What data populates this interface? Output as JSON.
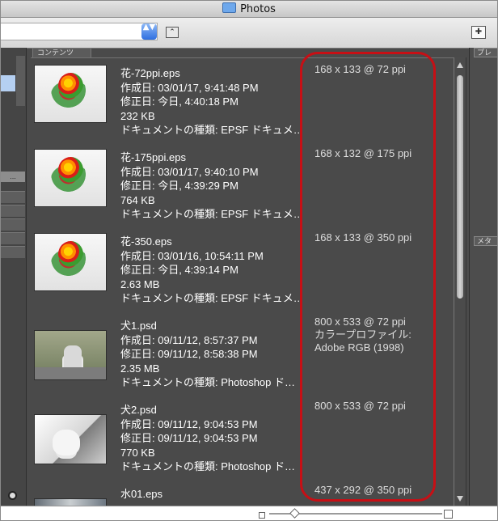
{
  "window": {
    "title": "Photos"
  },
  "toolbar": {
    "stepper": "▲▼",
    "up": "⌃",
    "new_folder": "✚"
  },
  "panels": {
    "left_header": "...",
    "content_tab": "コンテンツ",
    "right_tab_top": "プレ",
    "right_tab_mid": "メタ"
  },
  "items": [
    {
      "name": "花-72ppi.eps",
      "created": "作成日: 03/01/17, 9:41:48 PM",
      "modified": "修正日: 今日, 4:40:18 PM",
      "size": "232 KB",
      "kind": "ドキュメントの種類: EPSF ドキュメ…",
      "details": [
        "168 x 133 @ 72 ppi"
      ]
    },
    {
      "name": "花-175ppi.eps",
      "created": "作成日: 03/01/17, 9:40:10 PM",
      "modified": "修正日: 今日, 4:39:29 PM",
      "size": "764 KB",
      "kind": "ドキュメントの種類: EPSF ドキュメ…",
      "details": [
        "168 x 132 @ 175 ppi"
      ]
    },
    {
      "name": "花-350.eps",
      "created": "作成日: 03/01/16, 10:54:11 PM",
      "modified": "修正日: 今日, 4:39:14 PM",
      "size": "2.63 MB",
      "kind": "ドキュメントの種類: EPSF ドキュメ…",
      "details": [
        "168 x 133 @ 350 ppi"
      ]
    },
    {
      "name": "犬1.psd",
      "created": "作成日: 09/11/12, 8:57:37 PM",
      "modified": "修正日: 09/11/12, 8:58:38 PM",
      "size": "2.35 MB",
      "kind": "ドキュメントの種類: Photoshop ド…",
      "details": [
        "800 x 533 @ 72 ppi",
        "カラープロファイル:",
        "Adobe RGB (1998)"
      ]
    },
    {
      "name": "犬2.psd",
      "created": "作成日: 09/11/12, 9:04:53 PM",
      "modified": "修正日: 09/11/12, 9:04:53 PM",
      "size": "770 KB",
      "kind": "ドキュメントの種類: Photoshop ド…",
      "details": [
        "800 x 533 @ 72 ppi"
      ]
    },
    {
      "name": "水01.eps",
      "created": "",
      "modified": "",
      "size": "",
      "kind": "",
      "details": [
        "437 x 292 @ 350 ppi"
      ]
    }
  ],
  "colors": {
    "highlight": "#c70f15",
    "panel_bg": "#4a4a4a"
  }
}
